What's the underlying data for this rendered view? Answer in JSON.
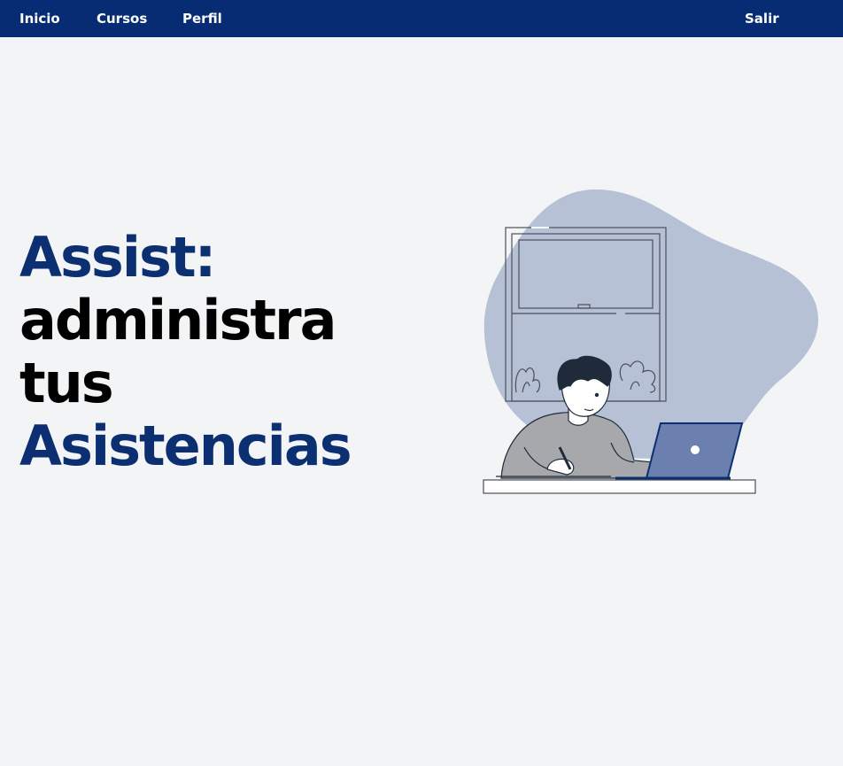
{
  "nav": {
    "links": [
      "Inicio",
      "Cursos",
      "Perfil"
    ],
    "logout": "Salir"
  },
  "hero": {
    "line1": "Assist:",
    "line2": "administra",
    "line3": "tus",
    "line4": "Asistencias"
  },
  "colors": {
    "nav_bg": "#082c74",
    "accent": "#0b2f70",
    "background": "#f3f4f6",
    "blob": "#b6c1d5",
    "laptop": "#6b80ae"
  },
  "illustration": {
    "icon": "student-laptop-illustration"
  }
}
